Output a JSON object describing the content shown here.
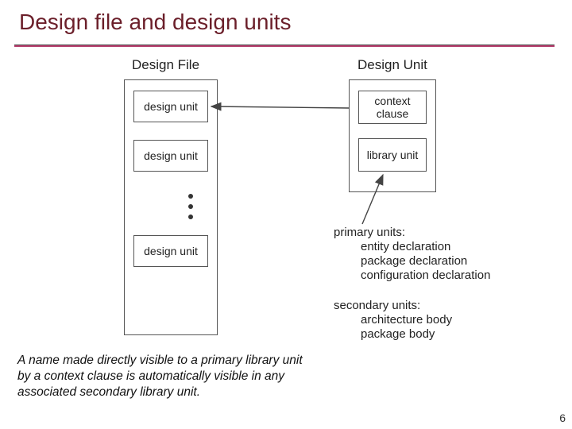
{
  "title": "Design file and design units",
  "diagram": {
    "left_label": "Design File",
    "right_label": "Design Unit",
    "left_boxes": [
      "design unit",
      "design unit",
      "design unit"
    ],
    "right_boxes": [
      "context clause",
      "library unit"
    ],
    "primary_heading": "primary units:",
    "primary_items": [
      "entity declaration",
      "package declaration",
      "configuration declaration"
    ],
    "secondary_heading": "secondary units:",
    "secondary_items": [
      "architecture body",
      "package body"
    ]
  },
  "footnote": "A name made directly visible to a primary library unit by a context clause is automatically visible in any associated secondary library unit.",
  "page_number": "6"
}
